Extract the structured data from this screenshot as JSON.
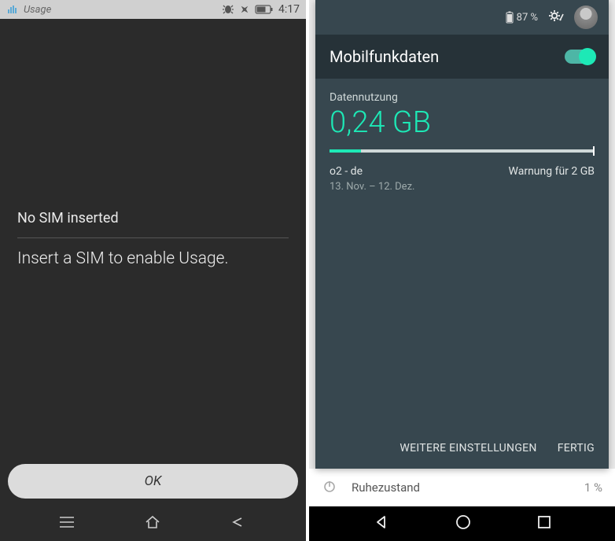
{
  "left": {
    "statusbar": {
      "app_title": "Usage",
      "time": "4:17"
    },
    "no_sim_title": "No SIM inserted",
    "insert_msg": "Insert a SIM to enable Usage.",
    "ok_label": "OK"
  },
  "right": {
    "statusbar": {
      "battery_pct": "87 %"
    },
    "title": "Mobilfunkdaten",
    "toggle_on": true,
    "usage_label": "Datennutzung",
    "usage_value": "0,24 GB",
    "carrier": "o2 - de",
    "warning": "Warnung für 2 GB",
    "date_range": "13. Nov. – 12. Dez.",
    "footer": {
      "more": "WEITERE EINSTELLUNGEN",
      "done": "FERTIG"
    },
    "bg_row": {
      "label": "Ruhezustand",
      "pct": "1 %"
    }
  }
}
